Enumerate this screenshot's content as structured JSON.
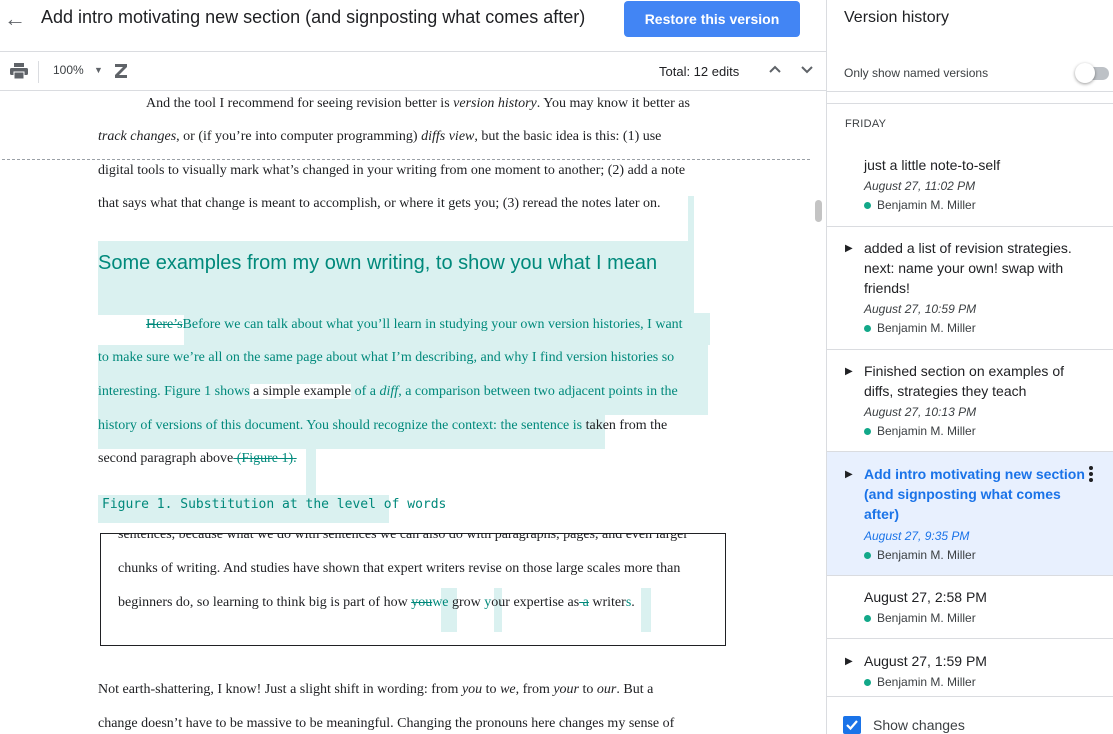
{
  "header": {
    "back_label": "←",
    "title": "Add intro motivating new section (and signposting what comes after)",
    "restore_label": "Restore this version"
  },
  "toolbar": {
    "zoom": "100%",
    "total_edits": "Total: 12 edits"
  },
  "document": {
    "p1": {
      "l1a": "And the tool I recommend for seeing revision better is ",
      "l1b": "version history",
      "l1c": ". You may know it better as",
      "l2a": "track changes",
      "l2b": ", or (if you’re into computer programming) ",
      "l2c": "diffs view",
      "l2d": ", but the basic idea is this: (1) use",
      "l3": "digital tools to visually mark what’s changed in your writing from one moment to another; (2) add a note",
      "l4": "that says what that change is meant to accomplish, or where it gets you; (3) reread the notes later on."
    },
    "heading": "Some examples from my own writing, to show you what I mean",
    "p2": {
      "l1del": "Here’s",
      "l1ins": "Before we can talk about what you’ll learn in studying your own version histories, I want",
      "l2": "to make sure we’re all on the same page about what I’m describing, and why I find version histories so",
      "l3a": "interesting. Figure 1 shows",
      "l3b": " a simple example",
      "l3c": " of a ",
      "l3d": "diff",
      "l3e": ", a comparison between two adjacent points in the",
      "l4a": "history of versions of this document. You should recognize the context: the sentence is",
      "l4b": " taken from the",
      "l5a": "second paragraph above",
      "l5b": " (Figure 1)",
      "l5c": "."
    },
    "figure_caption": "Figure 1. Substitution at the level of words",
    "figure": {
      "l1": "sentences, because what we do with sentences we can also do with paragraphs, pages, and even larger",
      "l2": "chunks of writing. And studies have shown that expert writers revise on those large scales more than",
      "l3a": "beginners do, so learning to think big is part of how ",
      "l3del1": "you",
      "l3ins1": "we",
      "l3b": " grow ",
      "l3ins2": "y",
      "l3c": "our expertise as",
      "l3del2": " a",
      "l3d": " writer",
      "l3ins3": "s",
      "l3e": "."
    },
    "p3": {
      "l1a": "Not earth-shattering, I know! Just a slight shift in wording: from ",
      "l1b": "you",
      "l1c": " to ",
      "l1d": "we",
      "l1e": ", from ",
      "l1f": "your",
      "l1g": " to ",
      "l1h": "our",
      "l1i": ". But a",
      "l2": "change doesn’t have to be massive to be meaningful. Changing the pronouns here changes my sense of"
    }
  },
  "panel": {
    "title": "Version history",
    "named_only_label": "Only show named versions",
    "named_only_on": false,
    "day_label": "FRIDAY",
    "versions": [
      {
        "title": "just a little note-to-self",
        "date": "August 27, 11:02 PM",
        "author": "Benjamin M. Miller",
        "expandable": false
      },
      {
        "title": "added a list of revision strategies. next: name your own! swap with friends!",
        "date": "August 27, 10:59 PM",
        "author": "Benjamin M. Miller",
        "expandable": true
      },
      {
        "title": "Finished section on examples of diffs, strategies they teach",
        "date": "August 27, 10:13 PM",
        "author": "Benjamin M. Miller",
        "expandable": true
      },
      {
        "title": "Add intro motivating new section (and signposting what comes after)",
        "date": "August 27, 9:35 PM",
        "author": "Benjamin M. Miller",
        "expandable": true,
        "selected": true
      },
      {
        "title": "August 27, 2:58 PM",
        "author": "Benjamin M. Miller",
        "expandable": false
      },
      {
        "title": "August 27, 1:59 PM",
        "author": "Benjamin M. Miller",
        "expandable": true
      }
    ],
    "show_changes_label": "Show changes",
    "show_changes_checked": true
  },
  "colors": {
    "accent": "#1a73e8",
    "restore_button": "#4285f4",
    "suggestion_text": "#00897b",
    "highlight": "#daf1f0",
    "author_dot": "#12a889",
    "selected_row": "#e8f0fe"
  }
}
